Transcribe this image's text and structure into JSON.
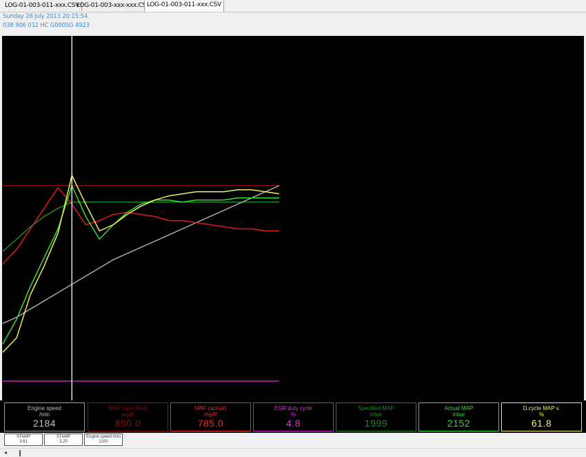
{
  "tabs": [
    {
      "label": "LOG-01-003-011-xxx.CSV",
      "active": false
    },
    {
      "label": "LOG-01-003-xxx-xxx.CSV",
      "active": false
    },
    {
      "label": "LOG-01-003-011-xxx.CSV",
      "active": true
    }
  ],
  "info": {
    "date": "Sunday 28 July 2013 20:15:54",
    "ident": "038 906 012 HC  G000SG  4923"
  },
  "chart_data": {
    "type": "line",
    "x": [
      0,
      1,
      2,
      3,
      4,
      5,
      6,
      7,
      8,
      9,
      10,
      11,
      12,
      13,
      14,
      15,
      16,
      17,
      18,
      19,
      20
    ],
    "cursor_x": 5,
    "series": [
      {
        "name": "Engine speed",
        "color": "#a9a9a9",
        "values": [
          0.28,
          0.31,
          0.35,
          0.39,
          0.43,
          0.47,
          0.51,
          0.55,
          0.59,
          0.62,
          0.65,
          0.68,
          0.71,
          0.74,
          0.77,
          0.8,
          0.83,
          0.86,
          0.89,
          0.92,
          0.95
        ]
      },
      {
        "name": "MAF (specified)",
        "color": "#8b1010",
        "values": [
          0.95,
          0.95,
          0.95,
          0.95,
          0.95,
          0.95,
          0.95,
          0.95,
          0.95,
          0.95,
          0.95,
          0.95,
          0.95,
          0.95,
          0.95,
          0.95,
          0.95,
          0.95,
          0.95,
          0.95,
          0.95
        ]
      },
      {
        "name": "MAF (actual)",
        "color": "#dd1c1c",
        "values": [
          0.57,
          0.64,
          0.74,
          0.84,
          0.94,
          0.86,
          0.76,
          0.78,
          0.81,
          0.82,
          0.81,
          0.8,
          0.78,
          0.78,
          0.77,
          0.76,
          0.75,
          0.74,
          0.74,
          0.73,
          0.73
        ]
      },
      {
        "name": "Specified MAP",
        "color": "#1e8a1e",
        "values": [
          0.63,
          0.69,
          0.75,
          0.8,
          0.84,
          0.87,
          0.87,
          0.87,
          0.87,
          0.87,
          0.87,
          0.87,
          0.87,
          0.87,
          0.87,
          0.87,
          0.87,
          0.87,
          0.87,
          0.87,
          0.87
        ]
      },
      {
        "name": "Actual MAP",
        "color": "#3ad93a",
        "values": [
          0.18,
          0.3,
          0.46,
          0.6,
          0.74,
          0.95,
          0.8,
          0.69,
          0.76,
          0.82,
          0.86,
          0.88,
          0.88,
          0.87,
          0.88,
          0.88,
          0.88,
          0.89,
          0.89,
          0.89,
          0.89
        ]
      },
      {
        "name": "D.cycle MAP v.",
        "color": "#f0f060",
        "values": [
          0.14,
          0.21,
          0.42,
          0.56,
          0.72,
          1.0,
          0.86,
          0.73,
          0.76,
          0.81,
          0.85,
          0.88,
          0.9,
          0.91,
          0.92,
          0.92,
          0.92,
          0.93,
          0.93,
          0.92,
          0.91
        ]
      },
      {
        "name": "EGR duty cycle",
        "color": "#c020c0",
        "values": [
          0,
          0,
          0,
          0,
          0,
          0,
          0,
          0,
          0,
          0,
          0,
          0,
          0,
          0,
          0,
          0,
          0,
          0,
          0,
          0,
          0
        ]
      }
    ]
  },
  "gauges": [
    {
      "name": "Engine speed",
      "unit": "/min",
      "value": "2184",
      "color": "#c0c0c0",
      "border": "#a0a0a0"
    },
    {
      "name": "MAF (specified)",
      "unit": "mg/R",
      "value": "850.0",
      "color": "#8b1010",
      "border": "#8b1010"
    },
    {
      "name": "MAF (actual)",
      "unit": "mg/R",
      "value": "785.0",
      "color": "#ee2a2a",
      "border": "#ee2a2a"
    },
    {
      "name": "EGR duty cycle",
      "unit": "%",
      "value": "4.8",
      "color": "#dd33dd",
      "border": "#c020c0"
    },
    {
      "name": "Specified MAP",
      "unit": "mbar",
      "value": "1999",
      "color": "#1e8a1e",
      "border": "#1e8a1e"
    },
    {
      "name": "Actual MAP",
      "unit": "mbar",
      "value": "2152",
      "color": "#3ad93a",
      "border": "#3ad93a"
    },
    {
      "name": "D.cycle MAP v.",
      "unit": "%",
      "value": "61.8",
      "color": "#f2f26a",
      "border": "#f2f26a"
    }
  ],
  "stamps": [
    {
      "label": "STAMP",
      "value": "3.61"
    },
    {
      "label": "STAMP",
      "value": "3.20"
    },
    {
      "label": "Engine speed /min",
      "value": "2100"
    }
  ],
  "scrollbar": {
    "left_arrow": "◂"
  }
}
